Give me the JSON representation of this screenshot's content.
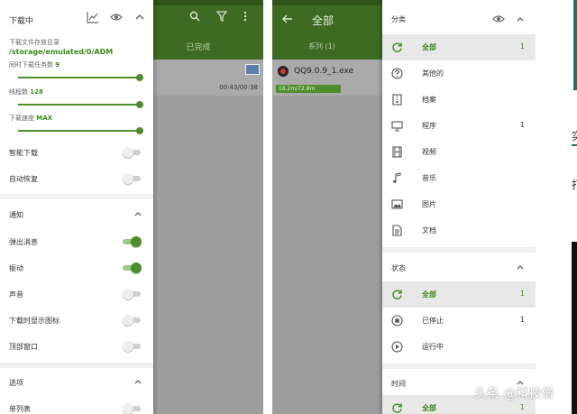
{
  "left": {
    "background": {
      "tab": "已完成",
      "time": "00:43/00:38"
    },
    "drawer": {
      "title": "下载中",
      "path_label": "下载文件存放目录",
      "path": "/storage/emulated/0/ADM",
      "sliders": [
        {
          "label": "同时下载任务数",
          "value": "9"
        },
        {
          "label": "线程数",
          "value": "128"
        },
        {
          "label": "下载速度",
          "value": "MAX"
        }
      ],
      "toggles_top": [
        {
          "label": "智能下载",
          "on": false
        },
        {
          "label": "自动恢复",
          "on": false
        }
      ],
      "notify_section": "通知",
      "toggles_notify": [
        {
          "label": "弹出消息",
          "on": true
        },
        {
          "label": "振动",
          "on": true
        },
        {
          "label": "声音",
          "on": false
        },
        {
          "label": "下载时显示图标",
          "on": false
        },
        {
          "label": "顶部窗口",
          "on": false
        }
      ],
      "options_section": "选项",
      "options_first": "单列表"
    }
  },
  "right": {
    "background": {
      "title": "全部",
      "tab": "系列 (1)",
      "file_name": "QQ9.0.9_1.exe",
      "progress_text": "16.2m/72.8m"
    },
    "drawer": {
      "category_title": "分类",
      "categories": [
        {
          "label": "全部",
          "count": "1",
          "icon": "refresh-icon",
          "selected": true
        },
        {
          "label": "其他的",
          "count": "",
          "icon": "question-icon",
          "selected": false
        },
        {
          "label": "档案",
          "count": "",
          "icon": "archive-icon",
          "selected": false
        },
        {
          "label": "程序",
          "count": "1",
          "icon": "monitor-icon",
          "selected": false
        },
        {
          "label": "视频",
          "count": "",
          "icon": "film-icon",
          "selected": false
        },
        {
          "label": "音乐",
          "count": "",
          "icon": "music-icon",
          "selected": false
        },
        {
          "label": "图片",
          "count": "",
          "icon": "image-icon",
          "selected": false
        },
        {
          "label": "文档",
          "count": "",
          "icon": "document-icon",
          "selected": false
        }
      ],
      "status_title": "状态",
      "statuses": [
        {
          "label": "全部",
          "count": "1",
          "icon": "refresh-icon",
          "selected": true
        },
        {
          "label": "已停止",
          "count": "1",
          "icon": "stop-icon",
          "selected": false
        },
        {
          "label": "运行中",
          "count": "",
          "icon": "play-icon",
          "selected": false
        }
      ],
      "time_title": "时间",
      "time_first": {
        "label": "全部",
        "count": "1"
      }
    }
  },
  "edge": {
    "char1": "实",
    "char2": "打"
  },
  "watermark": "头条 @科技僧",
  "colors": {
    "accent": "#3c8a1e",
    "toolbar": "#3e6b22"
  }
}
